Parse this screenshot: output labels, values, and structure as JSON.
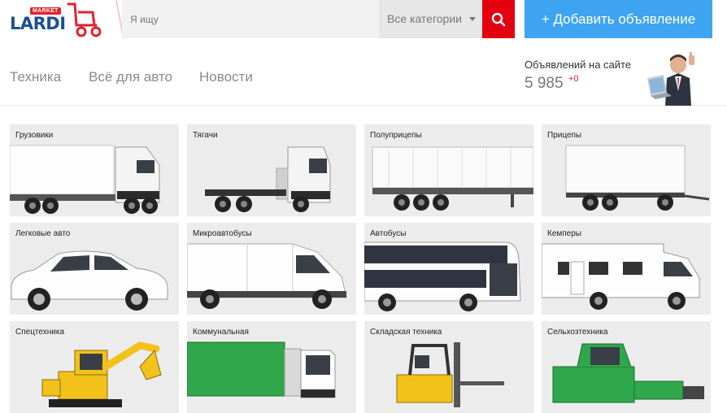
{
  "header": {
    "logo": {
      "market": "MARKET",
      "brand": "LARDI"
    },
    "search": {
      "placeholder": "Я ищу"
    },
    "category_select": {
      "selected": "Все категории"
    },
    "search_button_icon": "search-icon",
    "add_button_label": "+ Добавить объявление"
  },
  "nav": {
    "items": [
      {
        "label": "Техника"
      },
      {
        "label": "Всё для авто"
      },
      {
        "label": "Новости"
      }
    ],
    "counter": {
      "label": "Объявлений на сайте",
      "value": "5 985",
      "delta": "+0"
    }
  },
  "colors": {
    "accent_blue": "#3ea4f2",
    "search_red": "#e4000f",
    "brand_blue": "#1d4f91",
    "brand_red": "#e4202a",
    "tile_bg": "#ececec"
  },
  "categories": [
    {
      "label": "Грузовики"
    },
    {
      "label": "Тягачи"
    },
    {
      "label": "Полуприцепы"
    },
    {
      "label": "Прицепы"
    },
    {
      "label": "Легковые авто"
    },
    {
      "label": "Микроавтобусы"
    },
    {
      "label": "Автобусы"
    },
    {
      "label": "Кемперы"
    },
    {
      "label": "Спецтехника"
    },
    {
      "label": "Коммунальная"
    },
    {
      "label": "Складская техника"
    },
    {
      "label": "Сельхозтехника"
    }
  ]
}
